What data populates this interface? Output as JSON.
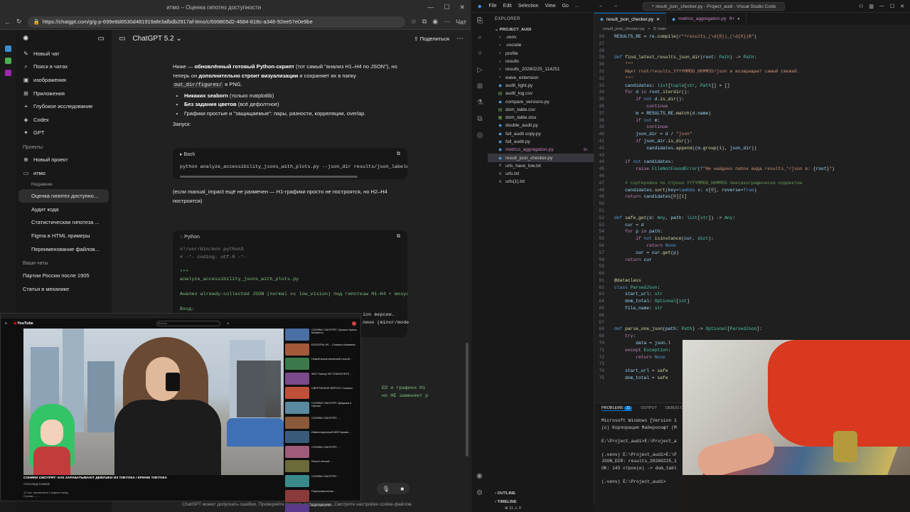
{
  "browser": {
    "window_title": "итмо – Оценка гипотез доступности",
    "url": "https://chatgpt.com/g/g-p-699e8d6530d481919afe3afbdb2917af-itmo/c/699805d2-4684-818c-a348-92ee57e0e9be",
    "profile_label": "Чат"
  },
  "gpt_sidebar": {
    "items": [
      {
        "label": "Новый чат",
        "icon": "edit-icon"
      },
      {
        "label": "Поиск в чатах",
        "icon": "search-icon"
      },
      {
        "label": "изображения",
        "icon": "image-icon"
      },
      {
        "label": "Приложения",
        "icon": "apps-icon"
      },
      {
        "label": "Глубокое исследование",
        "icon": "telescope-icon"
      },
      {
        "label": "Codex",
        "icon": "codex-icon"
      },
      {
        "label": "GPT",
        "icon": "gpt-icon"
      }
    ],
    "projects_heading": "Проекты",
    "projects": [
      {
        "label": "Новый проект"
      },
      {
        "label": "итмо"
      }
    ],
    "recent_label": "Недавние",
    "project_chats": [
      {
        "label": "Оценка гипотез доступно...",
        "active": true
      },
      {
        "label": "Аудит кода"
      },
      {
        "label": "Статистическая гипотеза ..."
      },
      {
        "label": "Figma в HTML примеры"
      },
      {
        "label": "Переименование файлов..."
      }
    ],
    "chats_heading": "Ваши чаты",
    "chats": [
      {
        "label": "Партии России после 1905"
      },
      {
        "label": "Статья в механике"
      }
    ]
  },
  "gpt_header": {
    "model": "ChatGPT 5.2",
    "share": "Поделиться"
  },
  "message": {
    "p1_a": "Ниже — ",
    "p1_b": "обновлённый готовый Python-скрипт",
    "p1_c": " (тот самый \"анализ H1–H4 по JSON\"), но теперь он ",
    "p1_d": "дополнительно строит визуализации",
    "p1_e": " и сохраняет их в папку ",
    "p1_code": "out_dir/figures/",
    "p1_f": " в PNG.",
    "bullets": [
      {
        "b": "Никаких seaborn",
        "t": " (только matplotlib)"
      },
      {
        "b": "Без задания цветов",
        "t": " (всё дефолтное)"
      },
      {
        "b": "",
        "t": "Графики простые и \"защищаемые\": пары, разности, корреляции, overlap."
      }
    ],
    "run_label": "Запуск:",
    "bash_label": "Bash",
    "bash_cmd": "python analyze_accessibility_jsons_with_plots.py --json_dir results/json_labeled",
    "after_note": "(если manual_impact ещё не размечен — H1-графики просто не построятся, но H2–H4 построятся)",
    "python_label": "Python",
    "py_lines": [
      "#!/usr/bin/env python3",
      "# -*- coding: utf-8 -*-",
      "",
      "\"\"\"",
      "analyze_accessibility_jsons_with_plots.py",
      "",
      "Анализ already-collected JSON (normal vs low_vision) под гипотезы H1–H4 + визуал",
      "",
      "Вход:"
    ],
    "hidden_tail_1": "ion версии.",
    "hidden_tail_2": "лено (minor/mode",
    "hidden_tail_3": "ED и графики H1",
    "hidden_tail_4": " но НЕ заменяет р",
    "footnote": "ChatGPT может допускать ошибки. Проверяйте важную информацию. Смотрите настройки cookie-файлов."
  },
  "youtube": {
    "logo_prefix": "▶",
    "logo": "YouTube",
    "search": "Искать",
    "video_title": "СОНЯКИ СМОТРЯТ: КАК ЗАРАБАТЫВАЮТ ДЕВУШКИ ИЗ ТИКТОКА / КРИНЖ ТИКТОКА",
    "channel": "Александр Климов",
    "desc_1": "12 тыс. просмотров  2 недели назад",
    "desc_2": "Стримы — ...",
    "rec_titles": [
      "СОНЯКИ СМОТРЯТ: Лучшие Кринж Моменты",
      "БЛОГЕРЫ НЕ... Сонякич Клименко",
      "Новый мошеннический способ ...",
      "ЖКУ Пикачу НЕ ПОЖАЛУЙТЕ ...",
      "СВЕРТАННОЕ ВЕРСУС Сонякич",
      "СОНЯКИ СМОТРЯТ: Девушки в тиктоке",
      "СОНЯКИ СМОТРЯТ: ...",
      "Инвестиционный МВП Армия ...",
      "СОНЯКИ СМОТРЯТ: ...",
      "Расчет пенсий ...",
      "СОНЯКИ СМОТРЯТ ...",
      "Переосмысление ...",
      "ВОЙ СМОТРЯТ: ...",
      "СОНЯКИ СМОТРЯТ: ..."
    ],
    "rec_colors": [
      "#4a6fa5",
      "#a35a3a",
      "#3a7a4a",
      "#7a4a8a",
      "#c0503a",
      "#5a8aa0",
      "#8a5a3a",
      "#3a5a7a",
      "#a05a7a",
      "#6a6a3a",
      "#3a8a8a",
      "#8a3a3a",
      "#5a3a8a",
      "#4a8a5a"
    ]
  },
  "vscode": {
    "menu": [
      "File",
      "Edit",
      "Selection",
      "View",
      "Go",
      "..."
    ],
    "title": "result_json_checker.py - Project_audi - Visual Studio Code",
    "explorer_label": "EXPLORER",
    "project": "PROJECT_AUDI",
    "files": [
      {
        "name": ".venv",
        "kind": "folder"
      },
      {
        "name": ".vscode",
        "kind": "folder"
      },
      {
        "name": "profile",
        "kind": "folder"
      },
      {
        "name": "results",
        "kind": "folder"
      },
      {
        "name": "results_20260225_114251",
        "kind": "folder"
      },
      {
        "name": "wave_extension",
        "kind": "folder"
      },
      {
        "name": "audit_light.py",
        "kind": "py"
      },
      {
        "name": "audit_log.csv",
        "kind": "csv"
      },
      {
        "name": "compare_versions.py",
        "kind": "py"
      },
      {
        "name": "dom_table.csv",
        "kind": "csv"
      },
      {
        "name": "dom_table.xlsx",
        "kind": "xlsx"
      },
      {
        "name": "double_audit.py",
        "kind": "py"
      },
      {
        "name": "full_audit copy.py",
        "kind": "py"
      },
      {
        "name": "full_audit.py",
        "kind": "py"
      },
      {
        "name": "metrics_aggregation.py",
        "kind": "py",
        "badge": "9+",
        "modified": true
      },
      {
        "name": "result_json_checker.py",
        "kind": "py",
        "selected": true
      },
      {
        "name": "urls_have_low.txt",
        "kind": "txt"
      },
      {
        "name": "urls.txt",
        "kind": "txt"
      },
      {
        "name": "urls(1).txt",
        "kind": "txt"
      }
    ],
    "outline": "OUTLINE",
    "timeline": "TIMELINE",
    "status": "⊗ 11  ⚠ 0",
    "tabs": [
      {
        "label": "result_json_checker.py",
        "active": true
      },
      {
        "label": "metrics_aggregation.py",
        "suffix": "9+",
        "modified": true
      }
    ],
    "breadcrumb": [
      "result_json_checker.py",
      ">",
      "⊙ main"
    ],
    "panel_tabs": [
      "PROBLEMS",
      "OUTPUT",
      "DEBUG C"
    ],
    "problems_count": "11",
    "terminal_lines": [
      "Microsoft Windows [Version 1",
      "(c) Корпорация Майкрософт (М",
      "",
      "E:\\Project_audi>E:\\Project_a",
      "",
      "(.venv) E:\\Project_audi>E:\\P",
      "JSON_DIR: results_20260225_1",
      "OK: 143 строк(и) -> dom_tabl",
      "",
      "(.venv) E:\\Project_audi>"
    ]
  },
  "code_lines": [
    {
      "n": "26",
      "html": "<span class='v'>RESULTS_RE</span> = <span class='v'>re</span>.<span class='f'>compile</span>(<span class='s'>r\"^results_(\\d{8})_(\\d{6})$\"</span>)"
    },
    {
      "n": "27",
      "html": ""
    },
    {
      "n": "28",
      "html": ""
    },
    {
      "n": "29",
      "html": "<span class='k'>def</span> <span class='f'>find_latest_results_json_dir</span>(<span class='v'>root</span>: <span class='ty'>Path</span>) -> <span class='ty'>Path</span>:"
    },
    {
      "n": "30",
      "html": "    <span class='s'>\"\"\"</span>"
    },
    {
      "n": "31",
      "html": "    <span class='s'>Ищет root/results_YYYYMMDD_HHMMSS/json и возвращает самый свежий.</span>"
    },
    {
      "n": "32",
      "html": "    <span class='s'>\"\"\"</span>"
    },
    {
      "n": "33",
      "html": "    <span class='v'>candidates</span>: <span class='ty'>list</span>[<span class='ty'>tuple</span>[<span class='ty'>str</span>, <span class='ty'>Path</span>]] = []"
    },
    {
      "n": "34",
      "html": "    <span class='kw'>for</span> <span class='v'>d</span> <span class='kw'>in</span> <span class='v'>root</span>.<span class='f'>iterdir</span>():"
    },
    {
      "n": "35",
      "html": "        <span class='kw'>if</span> <span class='k'>not</span> <span class='v'>d</span>.<span class='f'>is_dir</span>():"
    },
    {
      "n": "36",
      "html": "            <span class='kw'>continue</span>"
    },
    {
      "n": "37",
      "html": "        <span class='v'>m</span> = <span class='v'>RESULTS_RE</span>.<span class='f'>match</span>(<span class='v'>d</span>.<span class='v'>name</span>)"
    },
    {
      "n": "38",
      "html": "        <span class='kw'>if</span> <span class='k'>not</span> <span class='v'>m</span>:"
    },
    {
      "n": "39",
      "html": "            <span class='kw'>continue</span>"
    },
    {
      "n": "40",
      "html": "        <span class='v'>json_dir</span> = <span class='v'>d</span> / <span class='s'>\"json\"</span>"
    },
    {
      "n": "41",
      "html": "        <span class='kw'>if</span> <span class='v'>json_dir</span>.<span class='f'>is_dir</span>():"
    },
    {
      "n": "42",
      "html": "            <span class='v'>candidates</span>.<span class='f'>append</span>((<span class='v'>m</span>.<span class='f'>group</span>(<span class='nm'>1</span>), <span class='v'>json_dir</span>))"
    },
    {
      "n": "43",
      "html": ""
    },
    {
      "n": "44",
      "html": "    <span class='kw'>if</span> <span class='k'>not</span> <span class='v'>candidates</span>:"
    },
    {
      "n": "45",
      "html": "        <span class='kw'>raise</span> <span class='ty'>FileNotFoundError</span>(<span class='k'>f</span><span class='s'>\"Не найдено папок вида results_*/json в: </span>{<span class='v'>root</span>}<span class='s'>\"</span>)"
    },
    {
      "n": "46",
      "html": ""
    },
    {
      "n": "47",
      "html": "    <span class='cm'># сортировка по строке YYYYMMDD_HHMMSS лексикографически корректна</span>"
    },
    {
      "n": "48",
      "html": "    <span class='v'>candidates</span>.<span class='f'>sort</span>(<span class='v'>key</span>=<span class='k'>lambda</span> <span class='v'>x</span>: <span class='v'>x</span>[<span class='nm'>0</span>], <span class='v'>reverse</span>=<span class='k'>True</span>)"
    },
    {
      "n": "49",
      "html": "    <span class='kw'>return</span> <span class='v'>candidates</span>[<span class='nm'>0</span>][<span class='nm'>1</span>]"
    },
    {
      "n": "50",
      "html": ""
    },
    {
      "n": "51",
      "html": ""
    },
    {
      "n": "52",
      "html": "<span class='k'>def</span> <span class='f'>safe_get</span>(<span class='v'>d</span>: <span class='ty'>Any</span>, <span class='v'>path</span>: <span class='ty'>list</span>[<span class='ty'>str</span>]) -> <span class='ty'>Any</span>:"
    },
    {
      "n": "53",
      "html": "    <span class='v'>cur</span> = <span class='v'>d</span>"
    },
    {
      "n": "54",
      "html": "    <span class='kw'>for</span> <span class='v'>p</span> <span class='kw'>in</span> <span class='v'>path</span>:"
    },
    {
      "n": "55",
      "html": "        <span class='kw'>if</span> <span class='k'>not</span> <span class='f'>isinstance</span>(<span class='v'>cur</span>, <span class='ty'>dict</span>):"
    },
    {
      "n": "56",
      "html": "            <span class='kw'>return</span> <span class='k'>None</span>"
    },
    {
      "n": "57",
      "html": "        <span class='v'>cur</span> = <span class='v'>cur</span>.<span class='f'>get</span>(<span class='v'>p</span>)"
    },
    {
      "n": "58",
      "html": "    <span class='kw'>return</span> <span class='v'>cur</span>"
    },
    {
      "n": "59",
      "html": ""
    },
    {
      "n": "60",
      "html": ""
    },
    {
      "n": "61",
      "html": "<span class='f'>@dataclass</span>"
    },
    {
      "n": "62",
      "html": "<span class='k'>class</span> <span class='ty'>ParsedJson</span>:"
    },
    {
      "n": "63",
      "html": "    <span class='v'>start_url</span>: <span class='ty'>str</span>"
    },
    {
      "n": "64",
      "html": "    <span class='v'>dom_total</span>: <span class='ty'>Optional</span>[<span class='ty'>int</span>]"
    },
    {
      "n": "65",
      "html": "    <span class='v'>file_name</span>: <span class='ty'>str</span>"
    },
    {
      "n": "66",
      "html": ""
    },
    {
      "n": "67",
      "html": ""
    },
    {
      "n": "68",
      "html": "<span class='k'>def</span> <span class='f'>parse_one_json</span>(<span class='v'>path</span>: <span class='ty'>Path</span>) -> <span class='ty'>Optional</span>[<span class='ty'>ParsedJson</span>]:"
    },
    {
      "n": "69",
      "html": "    <span class='kw'>try</span>:"
    },
    {
      "n": "70",
      "html": "        <span class='v'>data</span> = <span class='v'>json</span>.l"
    },
    {
      "n": "71",
      "html": "    <span class='kw'>except</span> <span class='ty'>Exception</span>:"
    },
    {
      "n": "72",
      "html": "        <span class='kw'>return</span> <span class='k'>None</span>"
    },
    {
      "n": "73",
      "html": ""
    },
    {
      "n": "74",
      "html": "    <span class='v'>start_url</span> = <span class='f'>safe</span>"
    },
    {
      "n": "75",
      "html": "    <span class='v'>dom_total</span> = <span class='f'>safe</span>"
    }
  ]
}
